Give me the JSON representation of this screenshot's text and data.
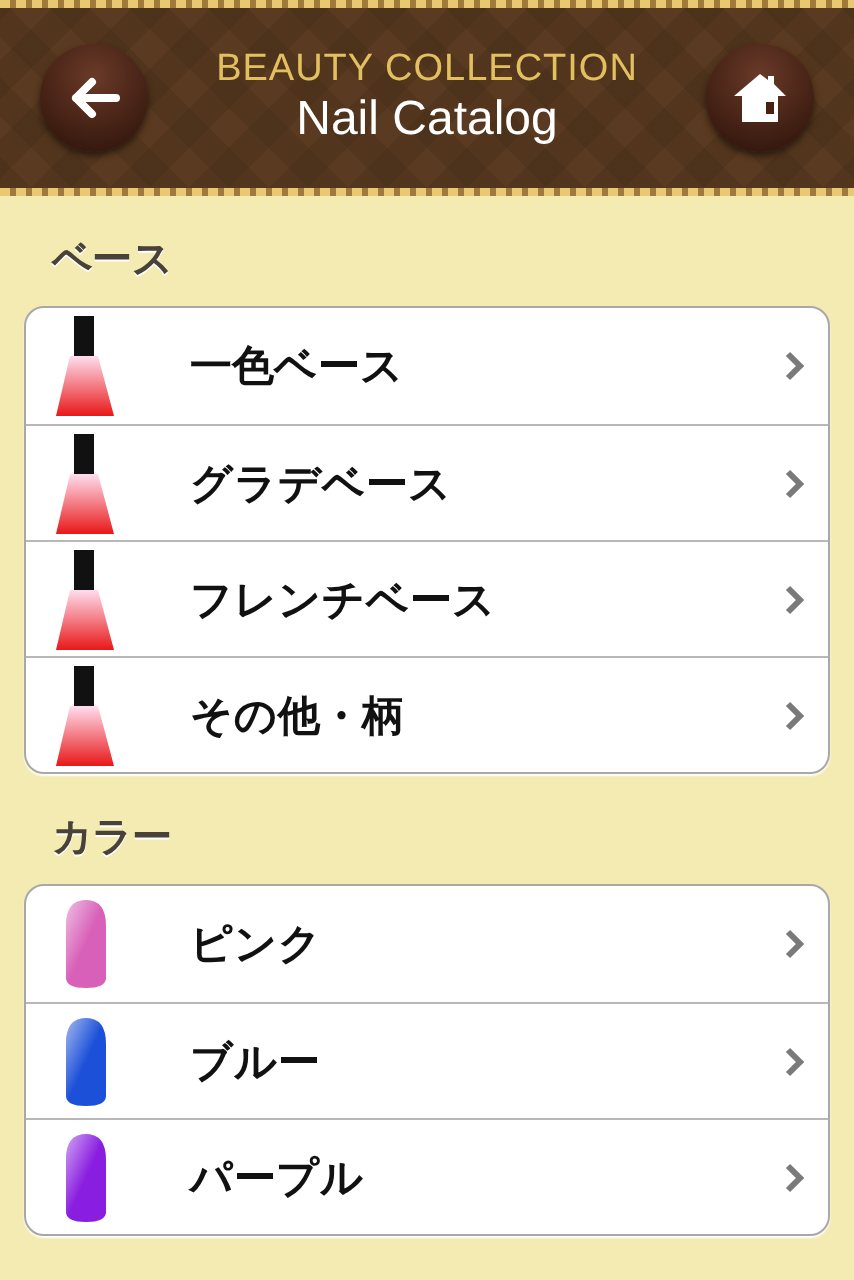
{
  "header": {
    "brand": "BEAUTY COLLECTION",
    "title": "Nail Catalog"
  },
  "sections": [
    {
      "title": "ベース",
      "items": [
        {
          "label": "一色ベース",
          "kind": "bottle"
        },
        {
          "label": "グラデベース",
          "kind": "bottle"
        },
        {
          "label": "フレンチベース",
          "kind": "bottle"
        },
        {
          "label": "その他・柄",
          "kind": "bottle"
        }
      ]
    },
    {
      "title": "カラー",
      "items": [
        {
          "label": "ピンク",
          "kind": "nail",
          "color": "#d860b8"
        },
        {
          "label": "ブルー",
          "kind": "nail",
          "color": "#1c50d8"
        },
        {
          "label": "パープル",
          "kind": "nail",
          "color": "#8a1ee0"
        }
      ]
    }
  ]
}
